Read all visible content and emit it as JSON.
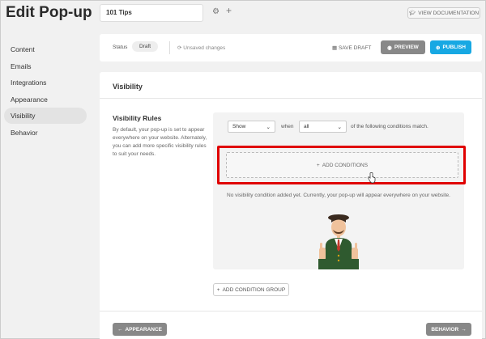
{
  "page": {
    "title": "Edit Pop-up"
  },
  "topbar": {
    "name_value": "101 Tips",
    "settings_icon": "gear-icon",
    "add_icon": "plus-icon",
    "view_docs_label": "VIEW DOCUMENTATION"
  },
  "sidebar": {
    "items": [
      {
        "label": "Content",
        "active": false
      },
      {
        "label": "Emails",
        "active": false
      },
      {
        "label": "Integrations",
        "active": false
      },
      {
        "label": "Appearance",
        "active": false
      },
      {
        "label": "Visibility",
        "active": true
      },
      {
        "label": "Behavior",
        "active": false
      }
    ]
  },
  "header": {
    "status_label": "Status",
    "status_value": "Draft",
    "unsaved_label": "Unsaved changes",
    "save_draft_label": "SAVE DRAFT",
    "preview_label": "PREVIEW",
    "publish_label": "PUBLISH"
  },
  "panel": {
    "title": "Visibility",
    "rules_title": "Visibility Rules",
    "rules_description": "By default, your pop-up is set to appear everywhere on your website. Alternately, you can add more specific visibility rules to suit your needs.",
    "show_select": "Show",
    "when_text": "when",
    "match_select": "all",
    "match_suffix": "of the following conditions match.",
    "add_conditions_label": "ADD CONDITIONS",
    "empty_message": "No visibility condition added yet. Currently, your pop-up will appear everywhere on your website.",
    "add_group_label": "ADD CONDITION GROUP"
  },
  "footer": {
    "prev_label": "APPEARANCE",
    "next_label": "BEHAVIOR"
  },
  "colors": {
    "primary": "#17a8e3",
    "gray_button": "#888888",
    "highlight": "#e00000"
  }
}
